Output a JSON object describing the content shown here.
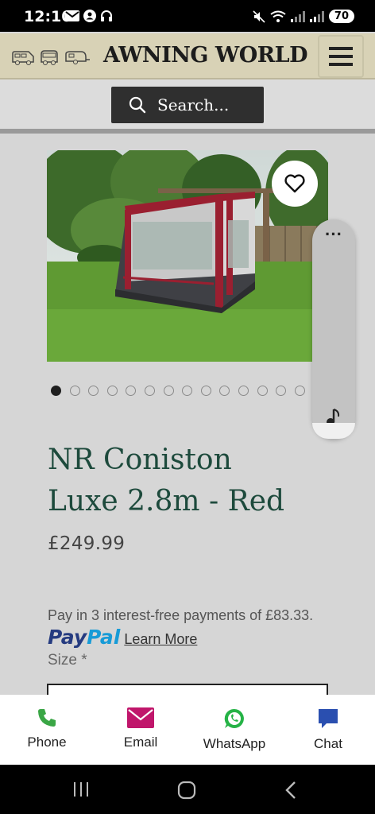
{
  "status_bar": {
    "time": "12:10",
    "battery": "70"
  },
  "header": {
    "logo": "AWNING WORLD",
    "icons": [
      "motorhome-icon",
      "campervan-icon",
      "caravan-icon",
      "hamburger-menu-icon"
    ]
  },
  "search": {
    "label": "Search..."
  },
  "product": {
    "image_alt": "Red and grey porch awning on grass",
    "title_line1": "NR Coniston",
    "title_line2": "Luxe 2.8m - Red",
    "price": "£249.99",
    "pay_text": "Pay in 3 interest-free payments of £83.33.",
    "paypal_brand_pay": "Pay",
    "paypal_brand_pal": "Pal",
    "learn_more": "Learn More",
    "size_label": "Size *",
    "gallery_count": 14,
    "gallery_active_index": 0
  },
  "contact_bar": {
    "items": [
      {
        "label": "Phone",
        "icon": "phone-icon",
        "color": "#3aa645"
      },
      {
        "label": "Email",
        "icon": "email-icon",
        "color": "#c0166b"
      },
      {
        "label": "WhatsApp",
        "icon": "whatsapp-icon",
        "color": "#25b346"
      },
      {
        "label": "Chat",
        "icon": "chat-icon",
        "color": "#2a4fb0"
      }
    ]
  },
  "colors": {
    "header_bg": "#d8d2b6",
    "title": "#1d4a3c",
    "search_bg": "#2f2f2f"
  }
}
